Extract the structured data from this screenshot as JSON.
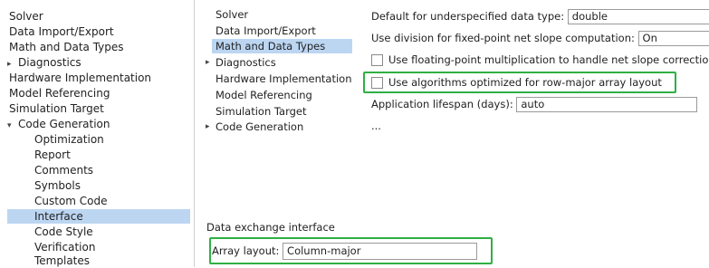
{
  "left_tree": {
    "items": [
      {
        "label": "Solver"
      },
      {
        "label": "Data Import/Export"
      },
      {
        "label": "Math and Data Types"
      },
      {
        "label": "Diagnostics",
        "arrow": "▸"
      },
      {
        "label": "Hardware Implementation"
      },
      {
        "label": "Model Referencing"
      },
      {
        "label": "Simulation Target"
      },
      {
        "label": "Code Generation",
        "arrow": "▾"
      },
      {
        "label": "Optimization"
      },
      {
        "label": "Report"
      },
      {
        "label": "Comments"
      },
      {
        "label": "Symbols"
      },
      {
        "label": "Custom Code"
      },
      {
        "label": "Interface",
        "selected": true
      },
      {
        "label": "Code Style"
      },
      {
        "label": "Verification"
      },
      {
        "label": "Templates"
      }
    ]
  },
  "mid_tree": {
    "items": [
      {
        "label": "Solver"
      },
      {
        "label": "Data Import/Export"
      },
      {
        "label": "Math and Data Types",
        "selected": true
      },
      {
        "label": "Diagnostics",
        "arrow": "▸"
      },
      {
        "label": "Hardware Implementation"
      },
      {
        "label": "Model Referencing"
      },
      {
        "label": "Simulation Target"
      },
      {
        "label": "Code Generation",
        "arrow": "▸"
      }
    ]
  },
  "settings": {
    "default_type_label": "Default for underspecified data type:",
    "default_type_value": "double",
    "division_label": "Use division for fixed-point net slope computation:",
    "division_value": "On",
    "float_mult_label": "Use floating-point multiplication to handle net slope corrections",
    "row_major_label": "Use algorithms optimized for row-major array layout",
    "lifespan_label": "Application lifespan (days):",
    "lifespan_value": "auto",
    "more": "..."
  },
  "interface": {
    "section_title": "Data exchange interface",
    "array_layout_label": "Array layout:",
    "array_layout_value": "Column-major"
  },
  "colors": {
    "selection": "#bcd6f2",
    "highlight": "#2fb043"
  }
}
